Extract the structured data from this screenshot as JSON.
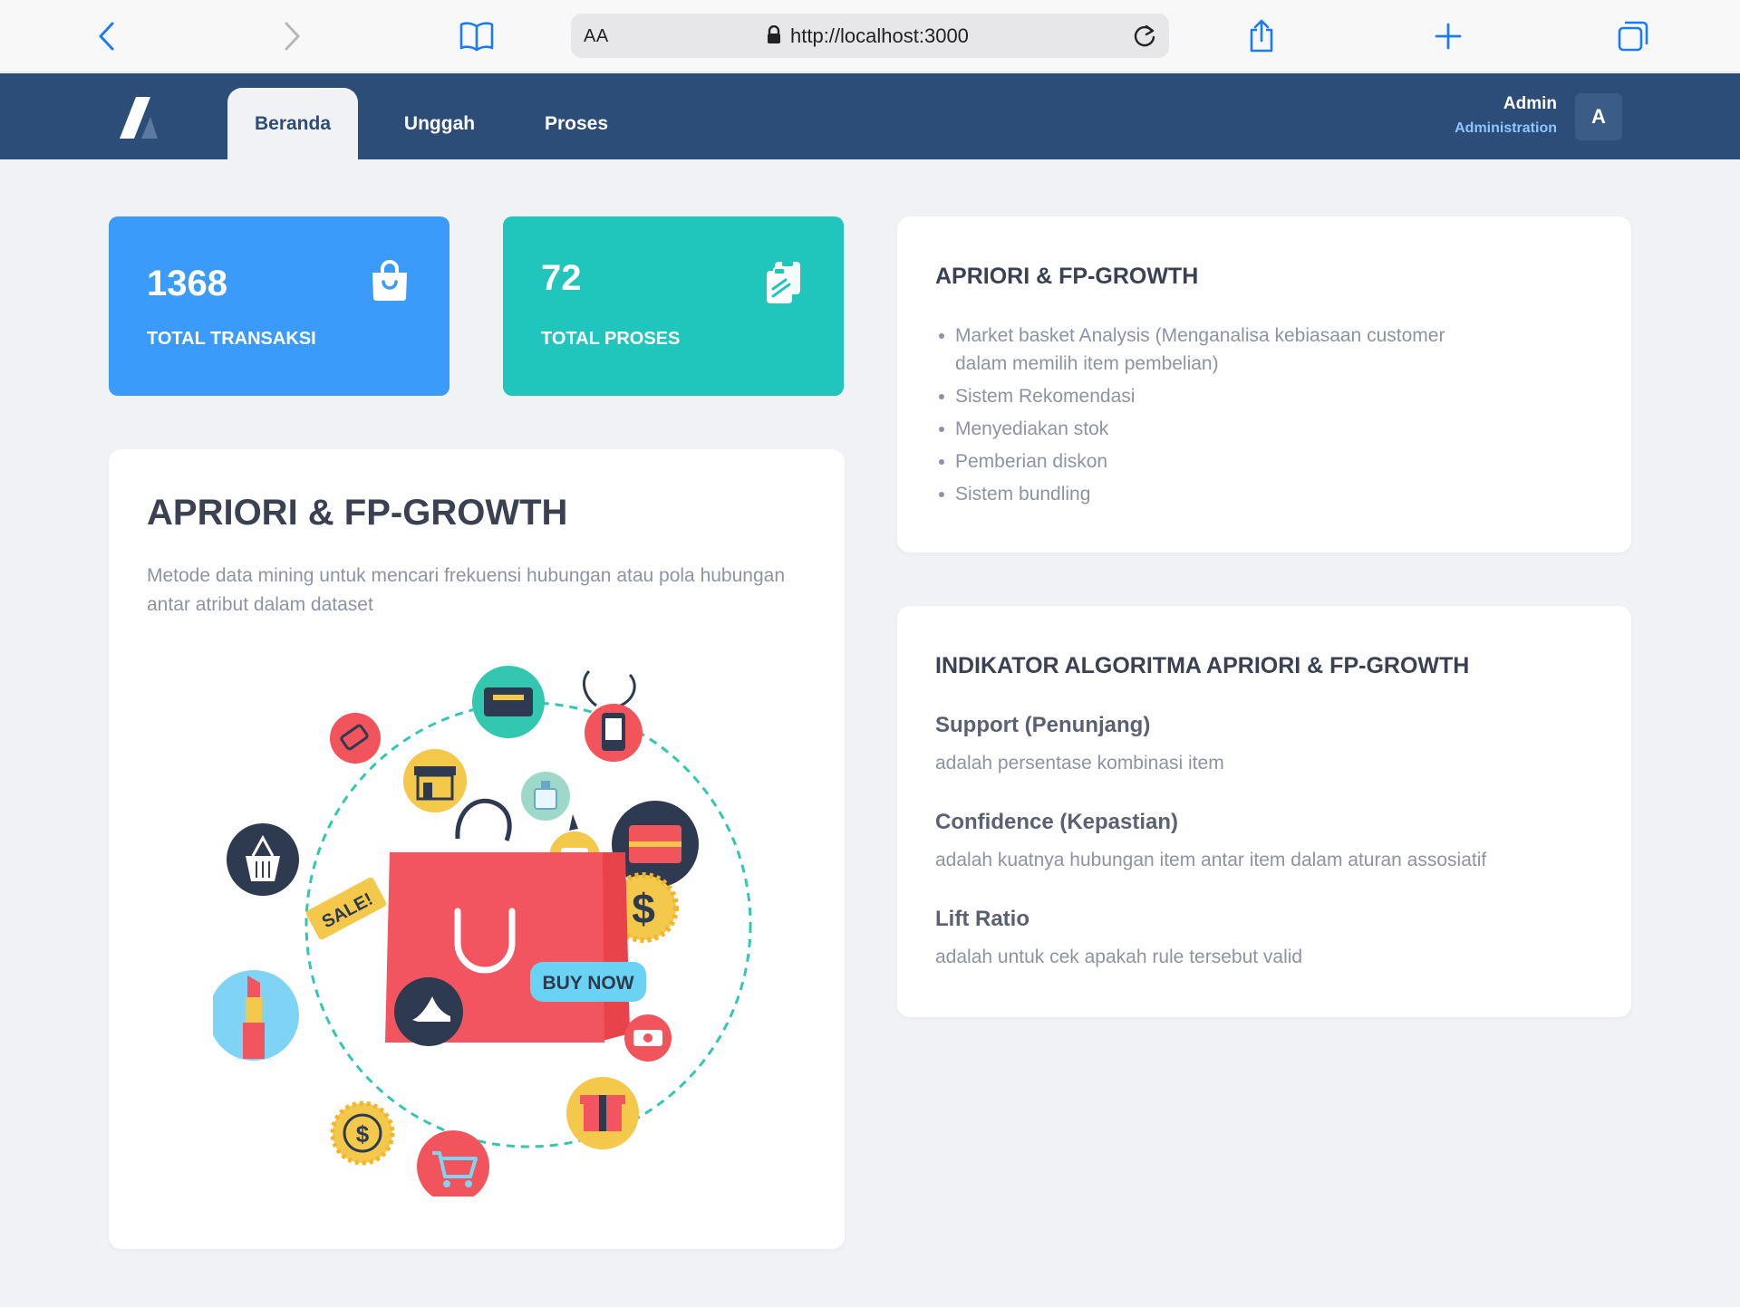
{
  "browser": {
    "text_size_label": "AA",
    "url": "http://localhost:3000"
  },
  "nav": {
    "tabs": [
      {
        "label": "Beranda",
        "active": true
      },
      {
        "label": "Unggah",
        "active": false
      },
      {
        "label": "Proses",
        "active": false
      }
    ],
    "user": {
      "name": "Admin",
      "role": "Administration",
      "initial": "A"
    }
  },
  "stats": [
    {
      "value": "1368",
      "label": "TOTAL TRANSAKSI",
      "color": "#3a9bfa",
      "icon": "shopping-bag-icon"
    },
    {
      "value": "72",
      "label": "TOTAL PROSES",
      "color": "#20c6bb",
      "icon": "clipboards-icon"
    }
  ],
  "hero": {
    "title": "APRIORI & FP-GROWTH",
    "description": "Metode data mining untuk mencari frekuensi hubungan atau pola hubungan antar atribut dalam dataset",
    "illustration": {
      "sale_tag": "SALE!",
      "buy_button": "BUY NOW"
    }
  },
  "uses_card": {
    "title": "APRIORI & FP-GROWTH",
    "items": [
      "Market basket Analysis (Menganalisa kebiasaan customer dalam memilih item pembelian)",
      "Sistem Rekomendasi",
      "Menyediakan stok",
      "Pemberian diskon",
      "Sistem bundling"
    ]
  },
  "indicators_card": {
    "title": "INDIKATOR ALGORITMA APRIORI & FP-GROWTH",
    "items": [
      {
        "name": "Support (Penunjang)",
        "description": "adalah persentase kombinasi item"
      },
      {
        "name": "Confidence (Kepastian)",
        "description": "adalah kuatnya hubungan item antar item dalam aturan assosiatif"
      },
      {
        "name": "Lift Ratio",
        "description": "adalah untuk cek apakah rule tersebut valid"
      }
    ]
  },
  "colors": {
    "nav_bg": "#2b4d78",
    "page_bg": "#f1f2f6",
    "accent_link": "#8cc6ff",
    "stat_blue": "#3a9bfa",
    "stat_teal": "#20c6bb",
    "safari_blue": "#1a7cf0"
  }
}
